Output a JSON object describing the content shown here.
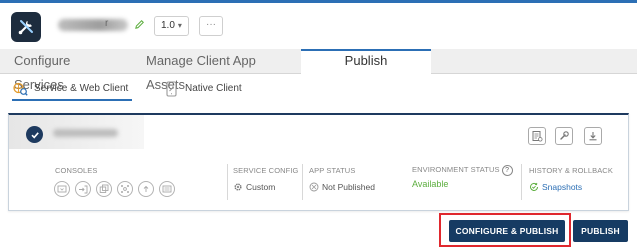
{
  "header": {
    "app_name_suffix": "r",
    "version": "1.0",
    "version_caret": "▾",
    "more_label": "···"
  },
  "main_tabs": [
    {
      "label": "Configure Services"
    },
    {
      "label": "Manage Client App Assets"
    },
    {
      "label": "Publish"
    }
  ],
  "sub_tabs": [
    {
      "label": "Service & Web Client"
    },
    {
      "label": "Native Client"
    }
  ],
  "card": {
    "consoles_label": "CONSOLES",
    "service_config": {
      "label": "SERVICE CONFIG",
      "value": "Custom"
    },
    "app_status": {
      "label": "APP STATUS",
      "value": "Not Published"
    },
    "environment_status": {
      "label": "ENVIRONMENT STATUS",
      "value": "Available",
      "help": "?"
    },
    "history": {
      "label": "HISTORY & ROLLBACK",
      "value": "Snapshots"
    }
  },
  "buttons": {
    "configure_publish": "CONFIGURE & PUBLISH",
    "publish": "PUBLISH"
  },
  "colors": {
    "accent": "#2c6fb5",
    "primary_button": "#163b63",
    "available": "#5dae3f",
    "highlight": "#e0282e"
  },
  "icons": [
    "tools-icon",
    "pencil-icon",
    "service-web-client-icon",
    "native-client-icon",
    "check-icon",
    "document-icon",
    "wrench-icon",
    "download-icon",
    "console-icons",
    "gear-icon",
    "status-icon",
    "snapshot-icon"
  ]
}
